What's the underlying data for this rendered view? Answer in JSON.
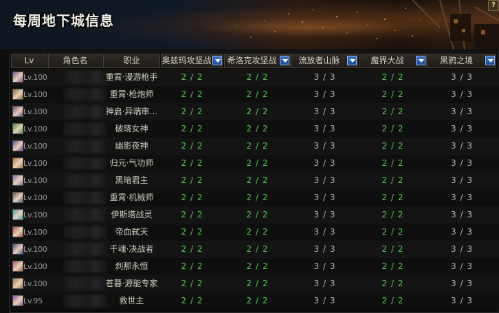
{
  "banner": {
    "title": "每周地下城信息",
    "help": "?"
  },
  "header": {
    "columns": [
      "Lv",
      "角色名",
      "职业",
      "奥兹玛攻坚战",
      "希洛克攻坚战",
      "流放者山脉",
      "魔界大战",
      "黑鸦之境"
    ]
  },
  "rows": [
    {
      "lv": "Lv.100",
      "job": "重霄·漫游枪手",
      "c1": "2 / 2",
      "c2": "2 / 2",
      "c3": "3 / 3",
      "c4": "2 / 2",
      "c5": "3 / 3",
      "avatar": "#7a5a8c"
    },
    {
      "lv": "Lv.100",
      "job": "重霄·枪炮师",
      "c1": "2 / 2",
      "c2": "2 / 2",
      "c3": "3 / 3",
      "c4": "2 / 2",
      "c5": "3 / 3",
      "avatar": "#8c6a3a"
    },
    {
      "lv": "Lv.100",
      "job": "神启·异端审…",
      "c1": "2 / 2",
      "c2": "2 / 2",
      "c3": "3 / 3",
      "c4": "2 / 2",
      "c5": "3 / 3",
      "avatar": "#6a4a7a"
    },
    {
      "lv": "Lv.100",
      "job": "破晓女神",
      "c1": "2 / 2",
      "c2": "2 / 2",
      "c3": "3 / 3",
      "c4": "2 / 2",
      "c5": "3 / 3",
      "avatar": "#4a8a4a"
    },
    {
      "lv": "Lv.100",
      "job": "幽影夜神",
      "c1": "2 / 2",
      "c2": "2 / 2",
      "c3": "3 / 3",
      "c4": "2 / 2",
      "c5": "3 / 3",
      "avatar": "#5a4a9a"
    },
    {
      "lv": "Lv.100",
      "job": "归元·气功师",
      "c1": "2 / 2",
      "c2": "2 / 2",
      "c3": "3 / 3",
      "c4": "2 / 2",
      "c5": "3 / 3",
      "avatar": "#b0783a"
    },
    {
      "lv": "Lv.100",
      "job": "黑暗君主",
      "c1": "2 / 2",
      "c2": "2 / 2",
      "c3": "3 / 3",
      "c4": "2 / 2",
      "c5": "3 / 3",
      "avatar": "#7a7aa8"
    },
    {
      "lv": "Lv.100",
      "job": "重霄·机械师",
      "c1": "2 / 2",
      "c2": "2 / 2",
      "c3": "3 / 3",
      "c4": "2 / 2",
      "c5": "3 / 3",
      "avatar": "#5a5a5a"
    },
    {
      "lv": "Lv.100",
      "job": "伊斯塔战灵",
      "c1": "2 / 2",
      "c2": "2 / 2",
      "c3": "3 / 3",
      "c4": "2 / 2",
      "c5": "3 / 3",
      "avatar": "#3aa8a8"
    },
    {
      "lv": "Lv.100",
      "job": "帝血弑天",
      "c1": "2 / 2",
      "c2": "2 / 2",
      "c3": "3 / 3",
      "c4": "2 / 2",
      "c5": "3 / 3",
      "avatar": "#a85a5a"
    },
    {
      "lv": "Lv.100",
      "job": "千魂·决战者",
      "c1": "2 / 2",
      "c2": "2 / 2",
      "c3": "3 / 3",
      "c4": "2 / 2",
      "c5": "3 / 3",
      "avatar": "#5a4a8a"
    },
    {
      "lv": "Lv.100",
      "job": "刹那永恒",
      "c1": "2 / 2",
      "c2": "2 / 2",
      "c3": "3 / 3",
      "c4": "2 / 2",
      "c5": "3 / 3",
      "avatar": "#b05a5a"
    },
    {
      "lv": "Lv.100",
      "job": "苍暮·源能专家",
      "c1": "2 / 2",
      "c2": "2 / 2",
      "c3": "3 / 3",
      "c4": "2 / 2",
      "c5": "3 / 3",
      "avatar": "#9a7a4a"
    },
    {
      "lv": "Lv.95",
      "job": "救世主",
      "c1": "2 / 2",
      "c2": "2 / 2",
      "c3": "3 / 3",
      "c4": "2 / 2",
      "c5": "3 / 3",
      "avatar": "#8a5aa8"
    }
  ],
  "colors": {
    "green": "#4fce4a",
    "gray": "#b5b5b5",
    "accent": "#2a5db0"
  }
}
